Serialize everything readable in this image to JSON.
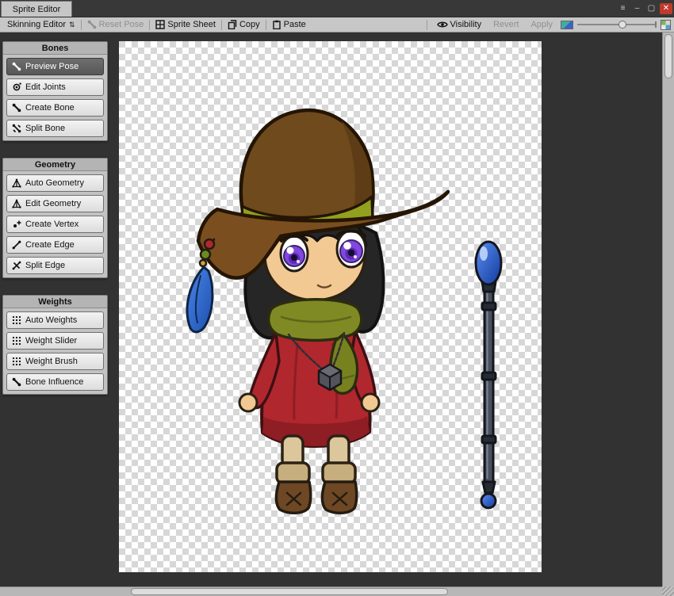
{
  "window": {
    "tab": "Sprite Editor"
  },
  "toolbar": {
    "mode_label": "Skinning Editor",
    "reset_pose": "Reset Pose",
    "sprite_sheet": "Sprite Sheet",
    "copy": "Copy",
    "paste": "Paste",
    "visibility": "Visibility",
    "revert": "Revert",
    "apply": "Apply",
    "zoom_slider_percent": 52
  },
  "panels": [
    {
      "title": "Bones",
      "items": [
        {
          "label": "Preview Pose",
          "icon": "bone-icon",
          "selected": true
        },
        {
          "label": "Edit Joints",
          "icon": "joint-icon",
          "selected": false
        },
        {
          "label": "Create Bone",
          "icon": "bone-icon",
          "selected": false
        },
        {
          "label": "Split Bone",
          "icon": "split-bone-icon",
          "selected": false
        }
      ]
    },
    {
      "title": "Geometry",
      "items": [
        {
          "label": "Auto Geometry",
          "icon": "mesh-icon",
          "selected": false
        },
        {
          "label": "Edit Geometry",
          "icon": "mesh-icon",
          "selected": false
        },
        {
          "label": "Create Vertex",
          "icon": "vertex-icon",
          "selected": false
        },
        {
          "label": "Create Edge",
          "icon": "edge-icon",
          "selected": false
        },
        {
          "label": "Split Edge",
          "icon": "split-edge-icon",
          "selected": false
        }
      ]
    },
    {
      "title": "Weights",
      "items": [
        {
          "label": "Auto Weights",
          "icon": "weight-dots-icon",
          "selected": false
        },
        {
          "label": "Weight Slider",
          "icon": "weight-dots-icon",
          "selected": false
        },
        {
          "label": "Weight Brush",
          "icon": "weight-dots-icon",
          "selected": false
        },
        {
          "label": "Bone Influence",
          "icon": "bone-icon",
          "selected": false
        }
      ]
    }
  ],
  "canvas": {
    "content": "chibi witch character sprite with magic staff on transparency checkerboard",
    "colors": {
      "canvas_bg": "#323232",
      "checker_light": "#ffffff",
      "checker_dark": "#d7d7d7",
      "hat": "#6f4a1d",
      "hat_band": "#93a01d",
      "hair": "#262626",
      "skin": "#f2c992",
      "eye_iris": "#8147de",
      "scarf": "#7f8a24",
      "dress": "#b1272e",
      "boots": "#6e4724",
      "feather": "#2b66c8",
      "staff_orb": "#1d4fc0",
      "staff_shaft": "#49505e"
    }
  }
}
